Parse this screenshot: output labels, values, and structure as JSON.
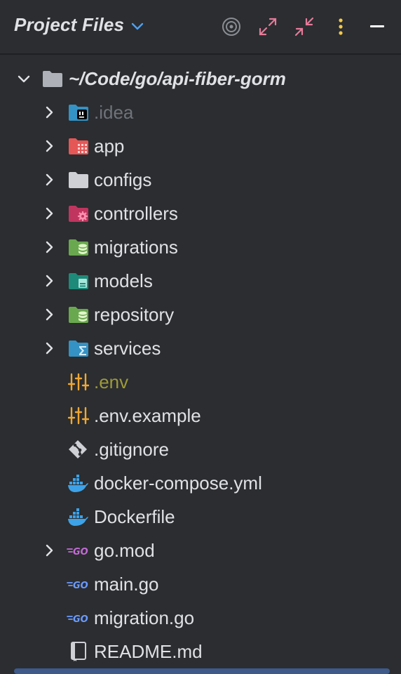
{
  "header": {
    "title": "Project Files",
    "actions": [
      "locate-icon",
      "expand-all-icon",
      "collapse-all-icon",
      "more-options-icon",
      "hide-icon"
    ]
  },
  "colors": {
    "background": "#2b2d30",
    "text": "#dfe1e5",
    "dim_text": "#6f737a",
    "env_text": "#9e9a3a",
    "accent_pink": "#e57b9a",
    "accent_yellow": "#f2c94c"
  },
  "tree": [
    {
      "label": "~/Code/go/api-fiber-gorm",
      "icon": "folder-icon",
      "expanded": true,
      "level": 0
    },
    {
      "label": ".idea",
      "icon": "idea-folder-icon",
      "expanded": false,
      "level": 1
    },
    {
      "label": "app",
      "icon": "app-folder-icon",
      "expanded": false,
      "level": 1
    },
    {
      "label": "configs",
      "icon": "folder-icon",
      "expanded": false,
      "level": 1
    },
    {
      "label": "controllers",
      "icon": "controllers-folder-icon",
      "expanded": false,
      "level": 1
    },
    {
      "label": "migrations",
      "icon": "database-folder-icon",
      "expanded": false,
      "level": 1
    },
    {
      "label": "models",
      "icon": "models-folder-icon",
      "expanded": false,
      "level": 1
    },
    {
      "label": "repository",
      "icon": "database-folder-icon",
      "expanded": false,
      "level": 1
    },
    {
      "label": "services",
      "icon": "services-folder-icon",
      "expanded": false,
      "level": 1
    },
    {
      "label": ".env",
      "icon": "env-file-icon",
      "level": 1
    },
    {
      "label": ".env.example",
      "icon": "env-file-icon",
      "level": 1
    },
    {
      "label": ".gitignore",
      "icon": "git-icon",
      "level": 1
    },
    {
      "label": "docker-compose.yml",
      "icon": "docker-icon",
      "level": 1
    },
    {
      "label": "Dockerfile",
      "icon": "docker-icon",
      "level": 1
    },
    {
      "label": "go.mod",
      "icon": "go-mod-icon",
      "expanded": false,
      "level": 1
    },
    {
      "label": "main.go",
      "icon": "go-file-icon",
      "level": 1
    },
    {
      "label": "migration.go",
      "icon": "go-file-icon",
      "level": 1
    },
    {
      "label": "README.md",
      "icon": "readme-icon",
      "level": 1
    }
  ]
}
